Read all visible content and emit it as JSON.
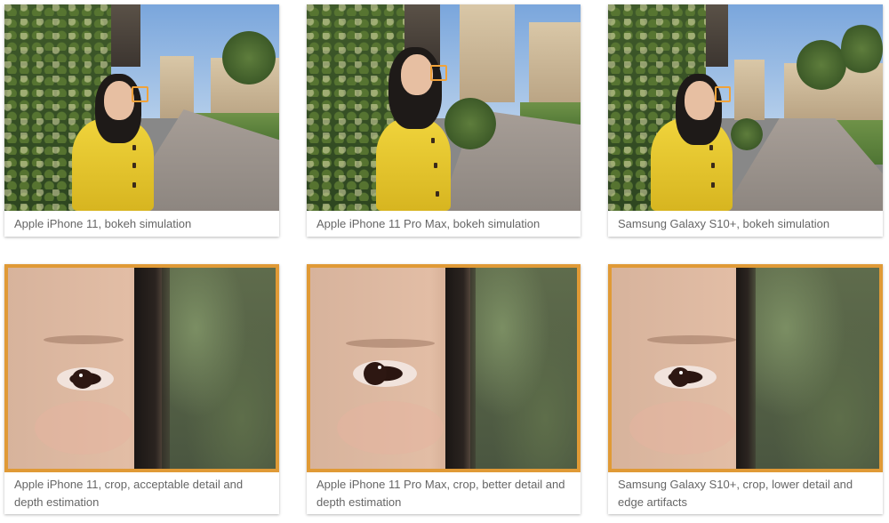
{
  "colors": {
    "caption_text": "#666666",
    "highlight_border": "#e09a36",
    "focus_box": "#f0a23a"
  },
  "rows": [
    {
      "cards": [
        {
          "caption": "Apple iPhone 11, bokeh simulation",
          "image": "portrait-bokeh-photo"
        },
        {
          "caption": "Apple iPhone 11 Pro Max, bokeh simulation",
          "image": "portrait-bokeh-photo"
        },
        {
          "caption": "Samsung Galaxy S10+, bokeh simulation",
          "image": "portrait-bokeh-photo"
        }
      ]
    },
    {
      "cards": [
        {
          "caption": "Apple iPhone 11, crop, acceptable detail and depth estimation",
          "image": "eye-crop-photo"
        },
        {
          "caption": "Apple iPhone 11 Pro Max, crop, better detail and depth estimation",
          "image": "eye-crop-photo"
        },
        {
          "caption": "Samsung Galaxy S10+, crop, lower detail and edge artifacts",
          "image": "eye-crop-photo"
        }
      ]
    }
  ]
}
